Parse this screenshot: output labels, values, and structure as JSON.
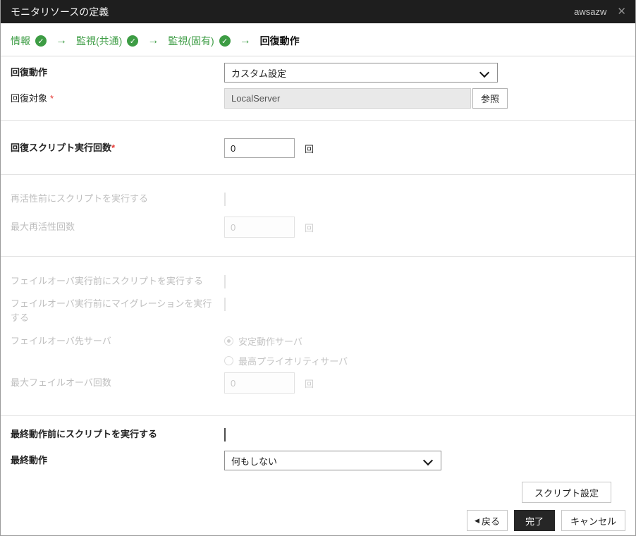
{
  "window": {
    "title": "モニタリソースの定義",
    "resource_name": "awsazw",
    "close_glyph": "✕"
  },
  "wizard": {
    "check_glyph": "✓",
    "arrow_glyph": "→",
    "steps": [
      {
        "label": "情報",
        "state": "done"
      },
      {
        "label": "監視(共通)",
        "state": "done"
      },
      {
        "label": "監視(固有)",
        "state": "done"
      },
      {
        "label": "回復動作",
        "state": "current"
      }
    ]
  },
  "form": {
    "recovery_action": {
      "label": "回復動作",
      "value": "カスタム設定"
    },
    "recovery_target": {
      "label": "回復対象",
      "required_mark": "*",
      "value": "LocalServer",
      "browse_label": "参照"
    },
    "recovery_script_count": {
      "label": "回復スクリプト実行回数",
      "required_mark": "*",
      "value": "0",
      "unit": "回",
      "enabled": true
    },
    "exec_script_before_reactivation": {
      "label": "再活性前にスクリプトを実行する",
      "checked": false,
      "enabled": false
    },
    "max_reactivation_count": {
      "label": "最大再活性回数",
      "value": "0",
      "unit": "回",
      "enabled": false
    },
    "exec_script_before_failover": {
      "label": "フェイルオーバ実行前にスクリプトを実行する",
      "checked": false,
      "enabled": false
    },
    "exec_migration_before_failover": {
      "label": "フェイルオーバ実行前にマイグレーションを実行する",
      "checked": false,
      "enabled": false
    },
    "failover_target_server": {
      "label": "フェイルオーバ先サーバ",
      "enabled": false,
      "options": [
        {
          "label": "安定動作サーバ",
          "selected": true
        },
        {
          "label": "最高プライオリティサーバ",
          "selected": false
        }
      ]
    },
    "max_failover_count": {
      "label": "最大フェイルオーバ回数",
      "value": "0",
      "unit": "回",
      "enabled": false
    },
    "exec_script_before_final_action": {
      "label": "最終動作前にスクリプトを実行する",
      "checked": false,
      "enabled": true
    },
    "final_action": {
      "label": "最終動作",
      "value": "何もしない"
    }
  },
  "buttons": {
    "script_settings": "スクリプト設定",
    "back": "戻る",
    "back_arrow_glyph": "◀",
    "finish": "完了",
    "cancel": "キャンセル"
  },
  "colors": {
    "accent_green": "#3d9c44",
    "titlebar_bg": "#1e1e1e",
    "finish_button_bg": "#262626",
    "required_red": "#e53935"
  }
}
